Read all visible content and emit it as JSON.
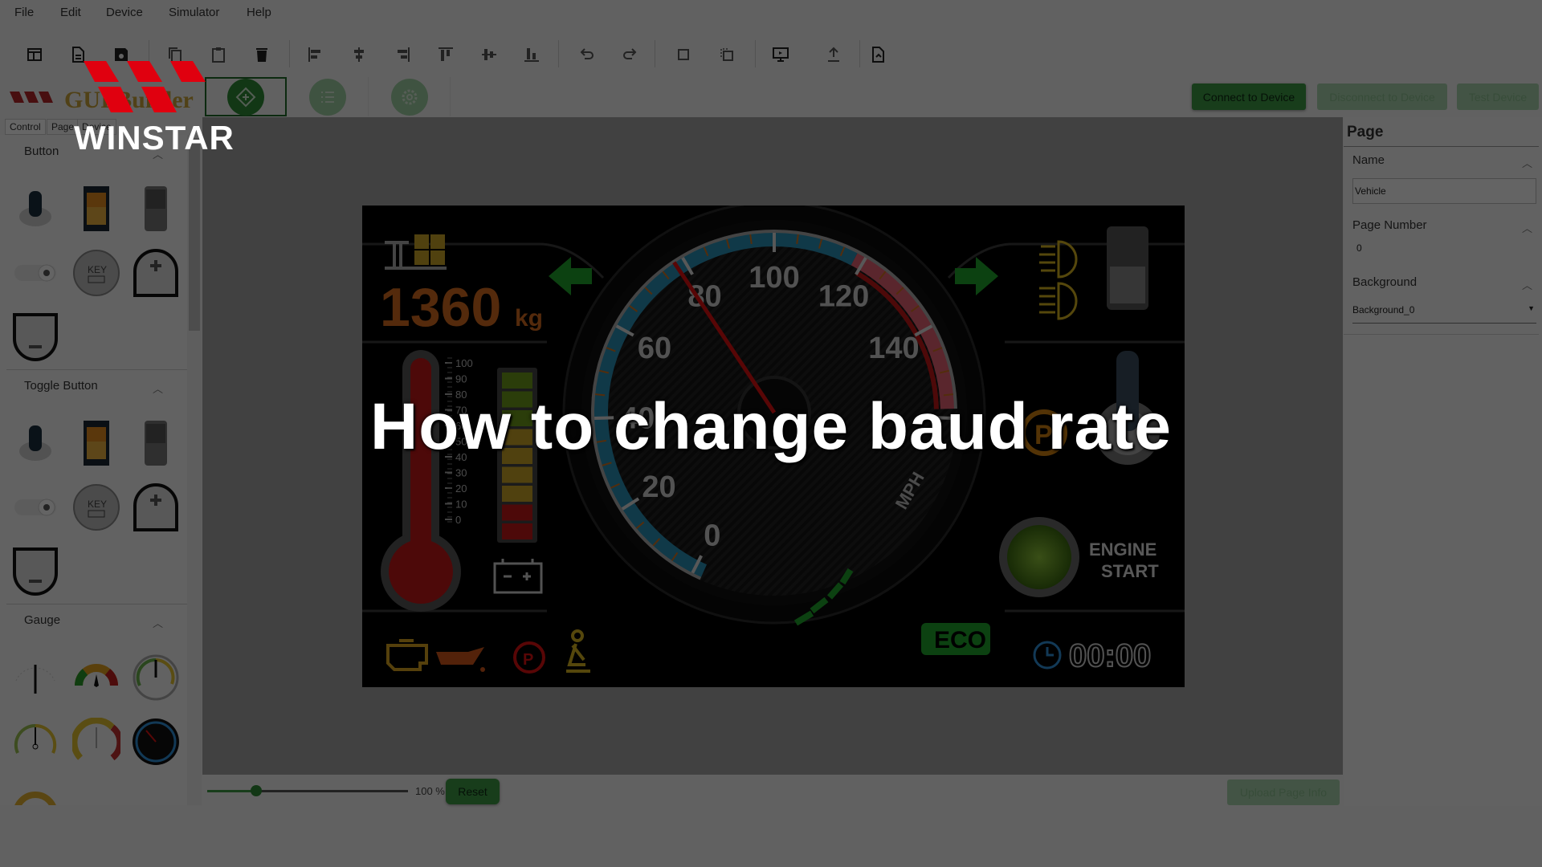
{
  "menu": [
    "File",
    "Edit",
    "Device",
    "Simulator",
    "Help"
  ],
  "toolbar": [
    "new-layout-icon",
    "new-file-icon",
    "save-icon",
    "copy-icon",
    "paste-icon",
    "delete-icon",
    "align-left-icon",
    "align-center-icon",
    "align-right-icon",
    "align-top-icon",
    "align-middle-icon",
    "align-bottom-icon",
    "undo-icon",
    "redo-icon",
    "bring-front-icon",
    "send-back-icon",
    "monitor-icon",
    "upload-icon",
    "export-file-icon"
  ],
  "app_logo": "GUI Builder",
  "modes": [
    {
      "icon": "design-icon",
      "active": true
    },
    {
      "icon": "list-icon",
      "active": false
    },
    {
      "icon": "settings-icon",
      "active": false
    }
  ],
  "device_buttons": {
    "connect": "Connect to Device",
    "disconnect": "Disconnect to Device",
    "test": "Test Device"
  },
  "left_tabs": [
    "Control",
    "Page",
    "Device"
  ],
  "palette": {
    "sections": [
      {
        "title": "Button",
        "items": [
          "toggle-lever",
          "rocker-switch",
          "slide-switch",
          "toggle-switch",
          "key-button",
          "plus-button",
          "minus-button"
        ]
      },
      {
        "title": "Toggle Button",
        "items": [
          "toggle-lever",
          "rocker-switch",
          "slide-switch",
          "toggle-switch",
          "key-button",
          "plus-button",
          "minus-button"
        ]
      },
      {
        "title": "Gauge",
        "items": [
          "needle-gauge",
          "color-gauge",
          "round-gauge",
          "arc-gauge",
          "ring-gauge",
          "speedometer-gauge",
          "half-gauge"
        ]
      }
    ]
  },
  "dashboard": {
    "weight_value": "1360",
    "weight_unit": "kg",
    "speed_ticks": [
      "0",
      "20",
      "40",
      "60",
      "80",
      "100",
      "120",
      "140"
    ],
    "speed_unit": "MPH",
    "speed_value": 78,
    "temp_ticks": [
      "100",
      "90",
      "80",
      "70",
      "60",
      "50",
      "40",
      "30",
      "20",
      "10",
      "0"
    ],
    "engine_label_1": "ENGINE",
    "engine_label_2": "START",
    "eco_label": "ECO",
    "clock": "00:00"
  },
  "zoom": {
    "value": "100 %",
    "level_percent": 100,
    "reset": "Reset"
  },
  "upload_button": "Upload Page Info",
  "properties": {
    "title": "Page",
    "name_label": "Name",
    "name_value": "Vehicle",
    "page_number_label": "Page Number",
    "page_number_value": "0",
    "background_label": "Background",
    "background_value": "Background_0"
  },
  "overlay": {
    "title": "How to change baud rate",
    "brand": "WINSTAR"
  },
  "colors": {
    "accent": "#3c9a45",
    "brand_red": "#e0000f"
  }
}
